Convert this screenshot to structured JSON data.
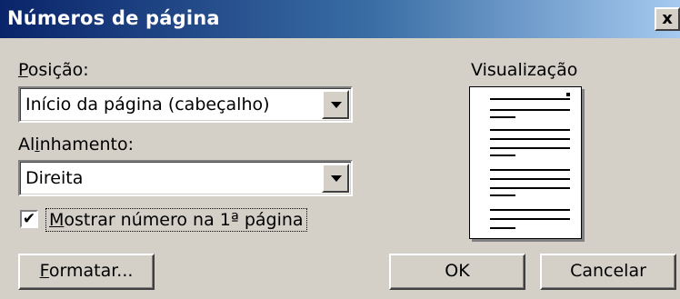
{
  "dialog": {
    "title": "Números de página",
    "close_label": "x"
  },
  "position": {
    "label_first": "P",
    "label_rest": "osição:",
    "value": "Início da página (cabeçalho)"
  },
  "alignment": {
    "label_first": "Al",
    "label_key": "i",
    "label_rest": "nhamento:",
    "value": "Direita"
  },
  "show_first_page": {
    "checked": true,
    "check_glyph": "✔",
    "label_key": "M",
    "label_rest": "ostrar número na 1ª página"
  },
  "preview": {
    "label": "Visualização"
  },
  "buttons": {
    "format_key": "F",
    "format_rest": "ormatar...",
    "ok": "OK",
    "cancel": "Cancelar"
  }
}
